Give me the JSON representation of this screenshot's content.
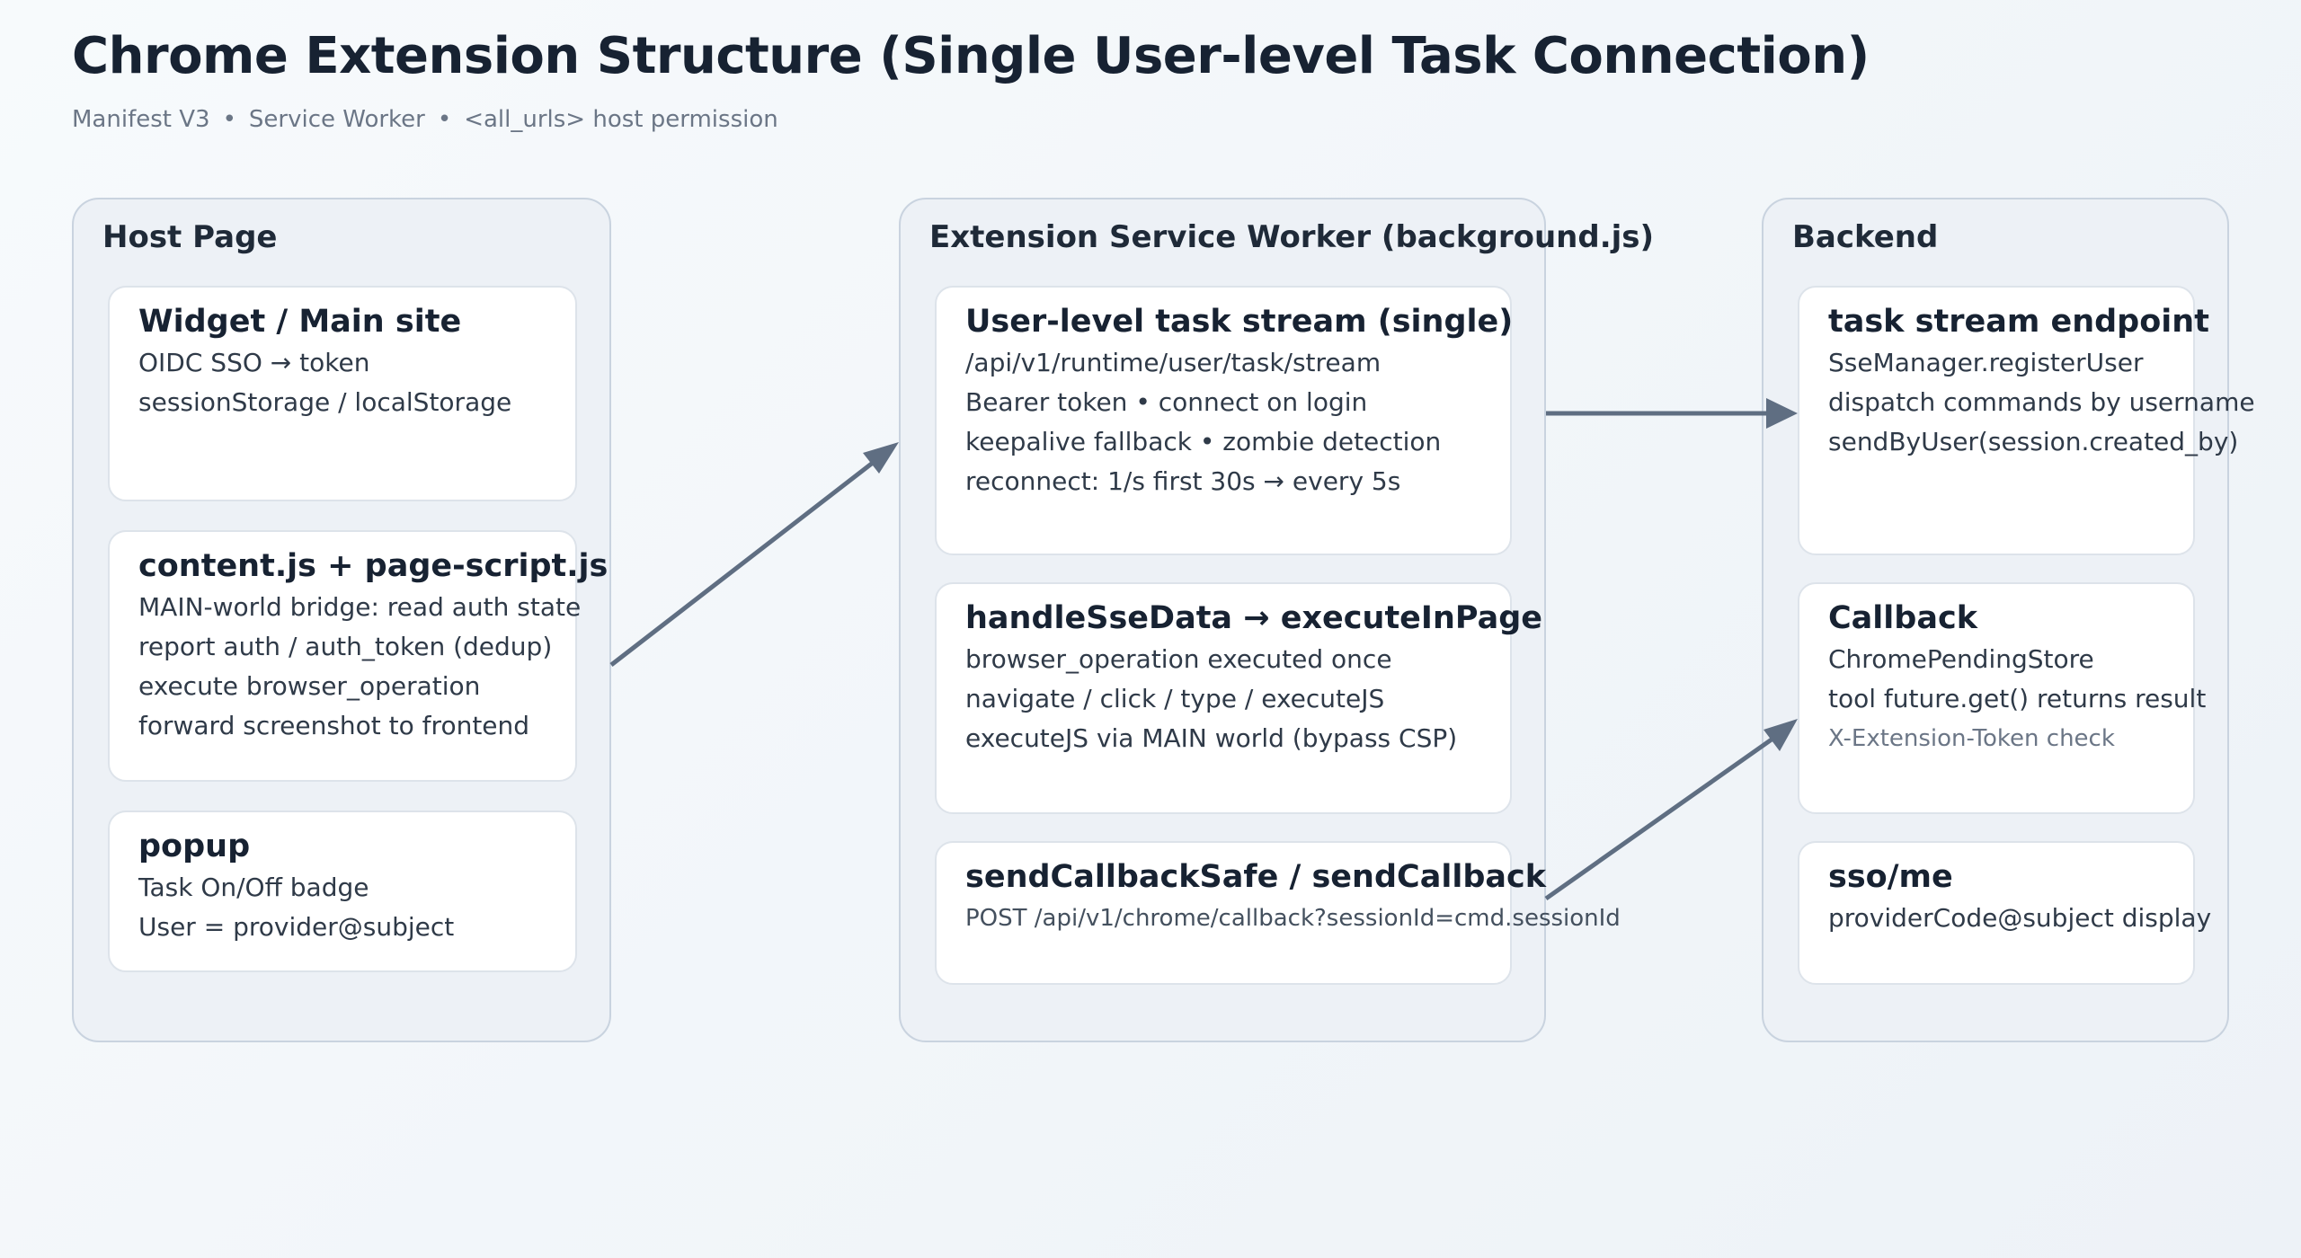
{
  "title": "Chrome Extension Structure (Single User-level Task Connection)",
  "subtitle": [
    "Manifest V3",
    "Service Worker",
    "<all_urls> host permission"
  ],
  "groups": [
    {
      "title": "Host Page",
      "cards": [
        {
          "title": "Widget / Main site",
          "lines": [
            "OIDC SSO → token",
            "sessionStorage / localStorage"
          ]
        },
        {
          "title": "content.js + page-script.js",
          "lines": [
            "MAIN-world bridge: read auth state",
            "report auth / auth_token (dedup)",
            "execute browser_operation",
            "forward screenshot to frontend"
          ]
        },
        {
          "title": "popup",
          "lines": [
            "Task On/Off badge",
            "User = provider@subject"
          ]
        }
      ]
    },
    {
      "title": "Extension Service Worker (background.js)",
      "cards": [
        {
          "title": "User-level task stream (single)",
          "lines": [
            "/api/v1/runtime/user/task/stream",
            "Bearer token  •  connect on login",
            "keepalive fallback  •  zombie detection",
            "reconnect: 1/s first 30s → every 5s"
          ]
        },
        {
          "title": "handleSseData → executeInPage",
          "lines": [
            "browser_operation executed once",
            "navigate / click / type / executeJS",
            "executeJS via MAIN world (bypass CSP)"
          ]
        },
        {
          "title": "sendCallbackSafe / sendCallback",
          "lines": [
            "POST /api/v1/chrome/callback?sessionId=cmd.sessionId"
          ]
        }
      ]
    },
    {
      "title": "Backend",
      "cards": [
        {
          "title": "task stream endpoint",
          "lines": [
            "SseManager.registerUser",
            "dispatch commands by username",
            "sendByUser(session.created_by)"
          ]
        },
        {
          "title": "Callback",
          "lines": [
            "ChromePendingStore",
            "tool future.get() returns result",
            "X-Extension-Token check"
          ]
        },
        {
          "title": "sso/me",
          "lines": [
            "providerCode@subject display"
          ]
        }
      ]
    }
  ],
  "colors": {
    "arrow": "#5f6e82",
    "group_bg": "#edf1f6",
    "card_bg": "#ffffff"
  }
}
